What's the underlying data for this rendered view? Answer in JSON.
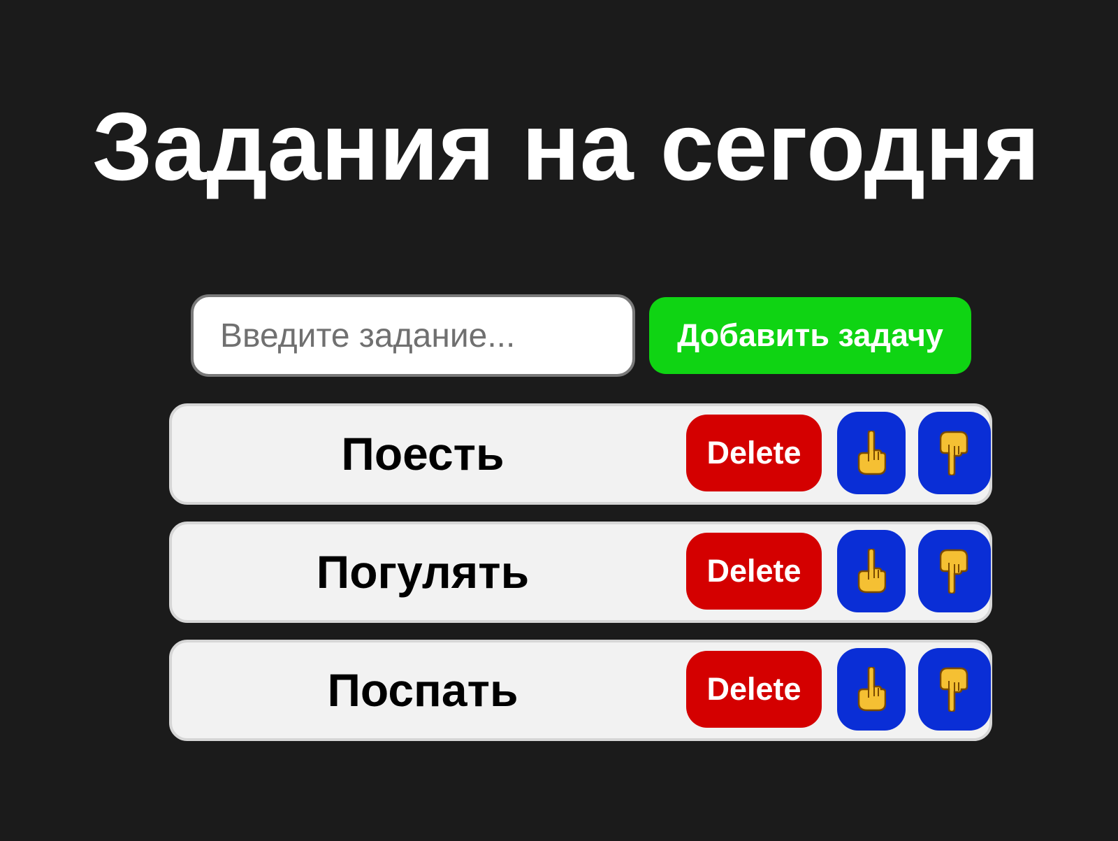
{
  "header": {
    "title": "Задания на сегодня"
  },
  "form": {
    "input_placeholder": "Введите задание...",
    "input_value": "",
    "add_button_label": "Добавить задачу"
  },
  "tasks": [
    {
      "label": "Поесть",
      "delete_label": "Delete",
      "up_icon": "hand-pointing-up-icon",
      "down_icon": "hand-pointing-down-icon"
    },
    {
      "label": "Погулять",
      "delete_label": "Delete",
      "up_icon": "hand-pointing-up-icon",
      "down_icon": "hand-pointing-down-icon"
    },
    {
      "label": "Поспать",
      "delete_label": "Delete",
      "up_icon": "hand-pointing-up-icon",
      "down_icon": "hand-pointing-down-icon"
    }
  ],
  "colors": {
    "background": "#1b1b1b",
    "add_button": "#0fd413",
    "delete_button": "#d40000",
    "move_button": "#0a2ed6",
    "task_item_bg": "#f2f2f2",
    "hand_icon": "#f5c033"
  }
}
